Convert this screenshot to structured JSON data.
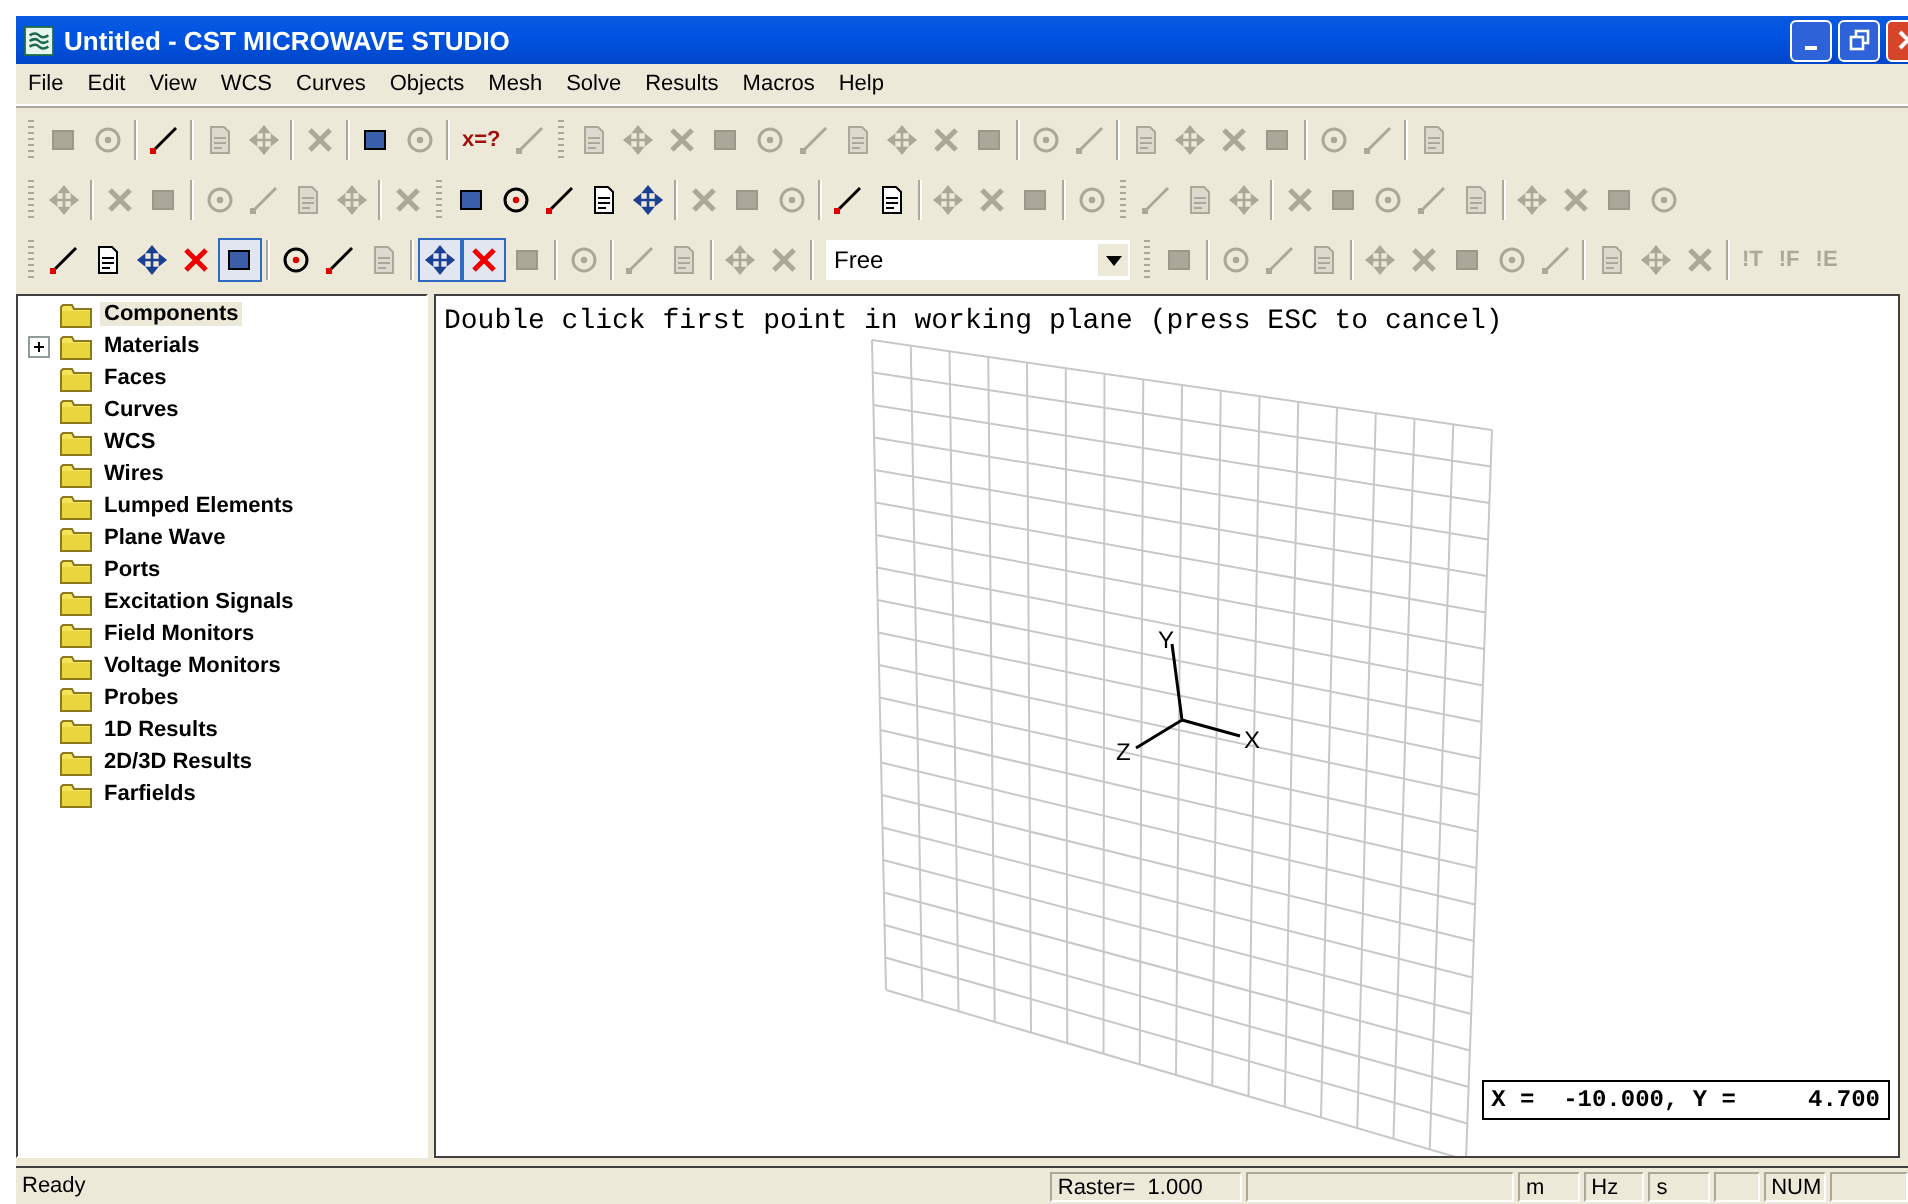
{
  "window": {
    "title": "Untitled - CST MICROWAVE STUDIO"
  },
  "menu": [
    "File",
    "Edit",
    "View",
    "WCS",
    "Curves",
    "Objects",
    "Mesh",
    "Solve",
    "Results",
    "Macros",
    "Help"
  ],
  "toolbars": [
    [
      {
        "kind": "grip"
      },
      {
        "kind": "tool",
        "disabled": true,
        "pressed": false
      },
      {
        "kind": "tool",
        "disabled": true,
        "pressed": false
      },
      {
        "kind": "separator"
      },
      {
        "kind": "tool",
        "disabled": false,
        "pressed": false
      },
      {
        "kind": "separator"
      },
      {
        "kind": "tool",
        "disabled": true,
        "pressed": false
      },
      {
        "kind": "tool",
        "disabled": true,
        "pressed": false
      },
      {
        "kind": "separator"
      },
      {
        "kind": "tool",
        "disabled": true,
        "pressed": false
      },
      {
        "kind": "separator"
      },
      {
        "kind": "tool",
        "disabled": false,
        "pressed": false
      },
      {
        "kind": "tool",
        "disabled": true,
        "pressed": false
      },
      {
        "kind": "separator"
      },
      {
        "kind": "text_tool",
        "label": "x=?",
        "disabled": false,
        "pressed": false
      },
      {
        "kind": "tool",
        "disabled": true,
        "pressed": false
      },
      {
        "kind": "grip"
      },
      {
        "kind": "tool",
        "disabled": true,
        "pressed": false
      },
      {
        "kind": "tool",
        "disabled": true,
        "pressed": false
      },
      {
        "kind": "tool",
        "disabled": true,
        "pressed": false
      },
      {
        "kind": "tool",
        "disabled": true,
        "pressed": false
      },
      {
        "kind": "tool",
        "disabled": true,
        "pressed": false
      },
      {
        "kind": "tool",
        "disabled": true,
        "pressed": false
      },
      {
        "kind": "tool",
        "disabled": true,
        "pressed": false
      },
      {
        "kind": "tool",
        "disabled": true,
        "pressed": false
      },
      {
        "kind": "tool",
        "disabled": true,
        "pressed": false
      },
      {
        "kind": "tool",
        "disabled": true,
        "pressed": false
      },
      {
        "kind": "separator"
      },
      {
        "kind": "tool",
        "disabled": true,
        "pressed": false
      },
      {
        "kind": "tool",
        "disabled": true,
        "pressed": false
      },
      {
        "kind": "separator"
      },
      {
        "kind": "tool",
        "disabled": true,
        "pressed": false
      },
      {
        "kind": "tool",
        "disabled": true,
        "pressed": false
      },
      {
        "kind": "tool",
        "disabled": true,
        "pressed": false
      },
      {
        "kind": "tool",
        "disabled": true,
        "pressed": false
      },
      {
        "kind": "separator"
      },
      {
        "kind": "tool",
        "disabled": true,
        "pressed": false
      },
      {
        "kind": "tool",
        "disabled": true,
        "pressed": false
      },
      {
        "kind": "separator"
      },
      {
        "kind": "tool",
        "disabled": true,
        "pressed": false
      }
    ],
    [
      {
        "kind": "grip"
      },
      {
        "kind": "tool",
        "disabled": true,
        "pressed": false
      },
      {
        "kind": "separator"
      },
      {
        "kind": "tool",
        "disabled": true,
        "pressed": false
      },
      {
        "kind": "tool",
        "disabled": true,
        "pressed": false
      },
      {
        "kind": "separator"
      },
      {
        "kind": "tool",
        "disabled": true,
        "pressed": false
      },
      {
        "kind": "tool",
        "disabled": true,
        "pressed": false
      },
      {
        "kind": "tool",
        "disabled": true,
        "pressed": false
      },
      {
        "kind": "tool",
        "disabled": true,
        "pressed": false
      },
      {
        "kind": "separator"
      },
      {
        "kind": "tool",
        "disabled": true,
        "pressed": false
      },
      {
        "kind": "grip"
      },
      {
        "kind": "tool",
        "disabled": false,
        "pressed": false
      },
      {
        "kind": "tool",
        "disabled": false,
        "pressed": false
      },
      {
        "kind": "tool",
        "disabled": false,
        "pressed": false
      },
      {
        "kind": "tool",
        "disabled": false,
        "pressed": false
      },
      {
        "kind": "tool",
        "disabled": false,
        "pressed": false
      },
      {
        "kind": "separator"
      },
      {
        "kind": "tool",
        "disabled": true,
        "pressed": false
      },
      {
        "kind": "tool",
        "disabled": true,
        "pressed": false
      },
      {
        "kind": "tool",
        "disabled": true,
        "pressed": false
      },
      {
        "kind": "separator"
      },
      {
        "kind": "tool",
        "disabled": false,
        "pressed": false
      },
      {
        "kind": "tool",
        "disabled": false,
        "pressed": false
      },
      {
        "kind": "separator"
      },
      {
        "kind": "tool",
        "disabled": true,
        "pressed": false
      },
      {
        "kind": "tool",
        "disabled": true,
        "pressed": false
      },
      {
        "kind": "tool",
        "disabled": true,
        "pressed": false
      },
      {
        "kind": "separator"
      },
      {
        "kind": "tool",
        "disabled": true,
        "pressed": false
      },
      {
        "kind": "grip"
      },
      {
        "kind": "tool",
        "disabled": true,
        "pressed": false
      },
      {
        "kind": "tool",
        "disabled": true,
        "pressed": false
      },
      {
        "kind": "tool",
        "disabled": true,
        "pressed": false
      },
      {
        "kind": "separator"
      },
      {
        "kind": "tool",
        "disabled": true,
        "pressed": false
      },
      {
        "kind": "tool",
        "disabled": true,
        "pressed": false
      },
      {
        "kind": "tool",
        "disabled": true,
        "pressed": false
      },
      {
        "kind": "tool",
        "disabled": true,
        "pressed": false
      },
      {
        "kind": "tool",
        "disabled": true,
        "pressed": false
      },
      {
        "kind": "separator"
      },
      {
        "kind": "tool",
        "disabled": true,
        "pressed": false
      },
      {
        "kind": "tool",
        "disabled": true,
        "pressed": false
      },
      {
        "kind": "tool",
        "disabled": true,
        "pressed": false
      },
      {
        "kind": "tool",
        "disabled": true,
        "pressed": false
      }
    ],
    [
      {
        "kind": "grip"
      },
      {
        "kind": "tool",
        "disabled": false,
        "pressed": false
      },
      {
        "kind": "tool",
        "disabled": false,
        "pressed": false
      },
      {
        "kind": "tool",
        "disabled": false,
        "pressed": false
      },
      {
        "kind": "tool",
        "disabled": false,
        "pressed": false
      },
      {
        "kind": "tool",
        "disabled": false,
        "pressed": true
      },
      {
        "kind": "separator"
      },
      {
        "kind": "tool",
        "disabled": false,
        "pressed": false
      },
      {
        "kind": "tool",
        "disabled": false,
        "pressed": false
      },
      {
        "kind": "tool",
        "disabled": true,
        "pressed": false
      },
      {
        "kind": "separator"
      },
      {
        "kind": "tool",
        "disabled": false,
        "pressed": true
      },
      {
        "kind": "tool",
        "disabled": false,
        "pressed": true
      },
      {
        "kind": "tool",
        "disabled": true,
        "pressed": false
      },
      {
        "kind": "separator"
      },
      {
        "kind": "tool",
        "disabled": true,
        "pressed": false
      },
      {
        "kind": "separator"
      },
      {
        "kind": "tool",
        "disabled": true,
        "pressed": false
      },
      {
        "kind": "tool",
        "disabled": true,
        "pressed": false
      },
      {
        "kind": "separator"
      },
      {
        "kind": "tool",
        "disabled": true,
        "pressed": false
      },
      {
        "kind": "tool",
        "disabled": true,
        "pressed": false
      },
      {
        "kind": "separator"
      },
      {
        "kind": "combo",
        "value": "Free"
      },
      {
        "kind": "grip"
      },
      {
        "kind": "tool",
        "disabled": true,
        "pressed": false
      },
      {
        "kind": "separator"
      },
      {
        "kind": "tool",
        "disabled": true,
        "pressed": false
      },
      {
        "kind": "tool",
        "disabled": true,
        "pressed": false
      },
      {
        "kind": "tool",
        "disabled": true,
        "pressed": false
      },
      {
        "kind": "separator"
      },
      {
        "kind": "tool",
        "disabled": true,
        "pressed": false
      },
      {
        "kind": "tool",
        "disabled": true,
        "pressed": false
      },
      {
        "kind": "tool",
        "disabled": true,
        "pressed": false
      },
      {
        "kind": "tool",
        "disabled": true,
        "pressed": false
      },
      {
        "kind": "tool",
        "disabled": true,
        "pressed": false
      },
      {
        "kind": "separator"
      },
      {
        "kind": "tool",
        "disabled": true,
        "pressed": false
      },
      {
        "kind": "tool",
        "disabled": true,
        "pressed": false
      },
      {
        "kind": "tool",
        "disabled": true,
        "pressed": false
      },
      {
        "kind": "separator"
      },
      {
        "kind": "text_tool",
        "label": "!T",
        "disabled": true,
        "pressed": false
      },
      {
        "kind": "text_tool",
        "label": "!F",
        "disabled": true,
        "pressed": false
      },
      {
        "kind": "text_tool",
        "label": "!E",
        "disabled": true,
        "pressed": false
      }
    ]
  ],
  "tree": [
    {
      "label": "Components",
      "selected": true,
      "expander": false
    },
    {
      "label": "Materials",
      "selected": false,
      "expander": true
    },
    {
      "label": "Faces",
      "selected": false,
      "expander": false
    },
    {
      "label": "Curves",
      "selected": false,
      "expander": false
    },
    {
      "label": "WCS",
      "selected": false,
      "expander": false
    },
    {
      "label": "Wires",
      "selected": false,
      "expander": false
    },
    {
      "label": "Lumped Elements",
      "selected": false,
      "expander": false
    },
    {
      "label": "Plane Wave",
      "selected": false,
      "expander": false
    },
    {
      "label": "Ports",
      "selected": false,
      "expander": false
    },
    {
      "label": "Excitation Signals",
      "selected": false,
      "expander": false
    },
    {
      "label": "Field Monitors",
      "selected": false,
      "expander": false
    },
    {
      "label": "Voltage Monitors",
      "selected": false,
      "expander": false
    },
    {
      "label": "Probes",
      "selected": false,
      "expander": false
    },
    {
      "label": "1D Results",
      "selected": false,
      "expander": false
    },
    {
      "label": "2D/3D Results",
      "selected": false,
      "expander": false
    },
    {
      "label": "Farfields",
      "selected": false,
      "expander": false
    }
  ],
  "viewport": {
    "message": "Double click first point in working plane (press ESC to cancel)",
    "axes": {
      "x": "X",
      "y": "Y",
      "z": "Z"
    },
    "coordinates": "X =  -10.000, Y =     4.700"
  },
  "status_bar": [
    {
      "kind": "message",
      "text": "Ready"
    },
    {
      "kind": "pane",
      "text": "Raster=  1.000"
    },
    {
      "kind": "pane"
    },
    {
      "kind": "pane",
      "text": "m"
    },
    {
      "kind": "pane",
      "text": "Hz"
    },
    {
      "kind": "pane",
      "text": "s"
    },
    {
      "kind": "pane"
    },
    {
      "kind": "pane",
      "text": "NUM"
    },
    {
      "kind": "pane"
    }
  ]
}
